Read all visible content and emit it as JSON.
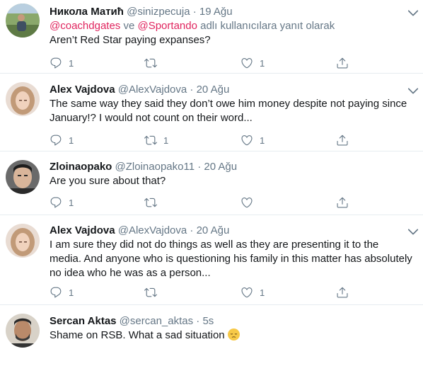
{
  "tweets": [
    {
      "name": "Никола Матић",
      "handle": "@sinizpecuja",
      "separator": "·",
      "time": "19 Ağu",
      "replying": {
        "mention1": "@coachdgates",
        "connector": " ve ",
        "mention2": "@Sportando",
        "suffix": " adlı kullanıcılara yanıt olarak"
      },
      "text": "Aren’t Red Star paying expanses?",
      "reply_count": "1",
      "retweet_count": "",
      "like_count": "1"
    },
    {
      "name": "Alex Vajdova",
      "handle": "@AlexVajdova",
      "separator": "·",
      "time": "20 Ağu",
      "text": "The same way they said they don’t owe him money despite not paying since January!? I would not count on their word...",
      "reply_count": "1",
      "retweet_count": "1",
      "like_count": "1"
    },
    {
      "name": "Zloinaopako",
      "handle": "@Zloinaopako11",
      "separator": "·",
      "time": "20 Ağu",
      "text": "Are you sure about that?",
      "reply_count": "1",
      "retweet_count": "",
      "like_count": ""
    },
    {
      "name": "Alex Vajdova",
      "handle": "@AlexVajdova",
      "separator": "·",
      "time": "20 Ağu",
      "text": "I am sure they did not do things as well as they are presenting it to the media. And anyone who is questioning his family in this matter has absolutely no idea who he was as a person...",
      "reply_count": "1",
      "retweet_count": "",
      "like_count": "1"
    },
    {
      "name": "Sercan Aktas",
      "handle": "@sercan_aktas",
      "separator": "·",
      "time": "5s",
      "text": "Shame on RSB. What a sad situation",
      "emoji": "pensive-face-emoji"
    }
  ],
  "icons": {
    "reply": "reply-icon",
    "retweet": "retweet-icon",
    "like": "heart-icon",
    "share": "share-icon",
    "more": "chevron-down-icon"
  },
  "colors": {
    "mention": "#e0245e",
    "secondary_text": "#657786",
    "divider": "#e6ecf0"
  }
}
